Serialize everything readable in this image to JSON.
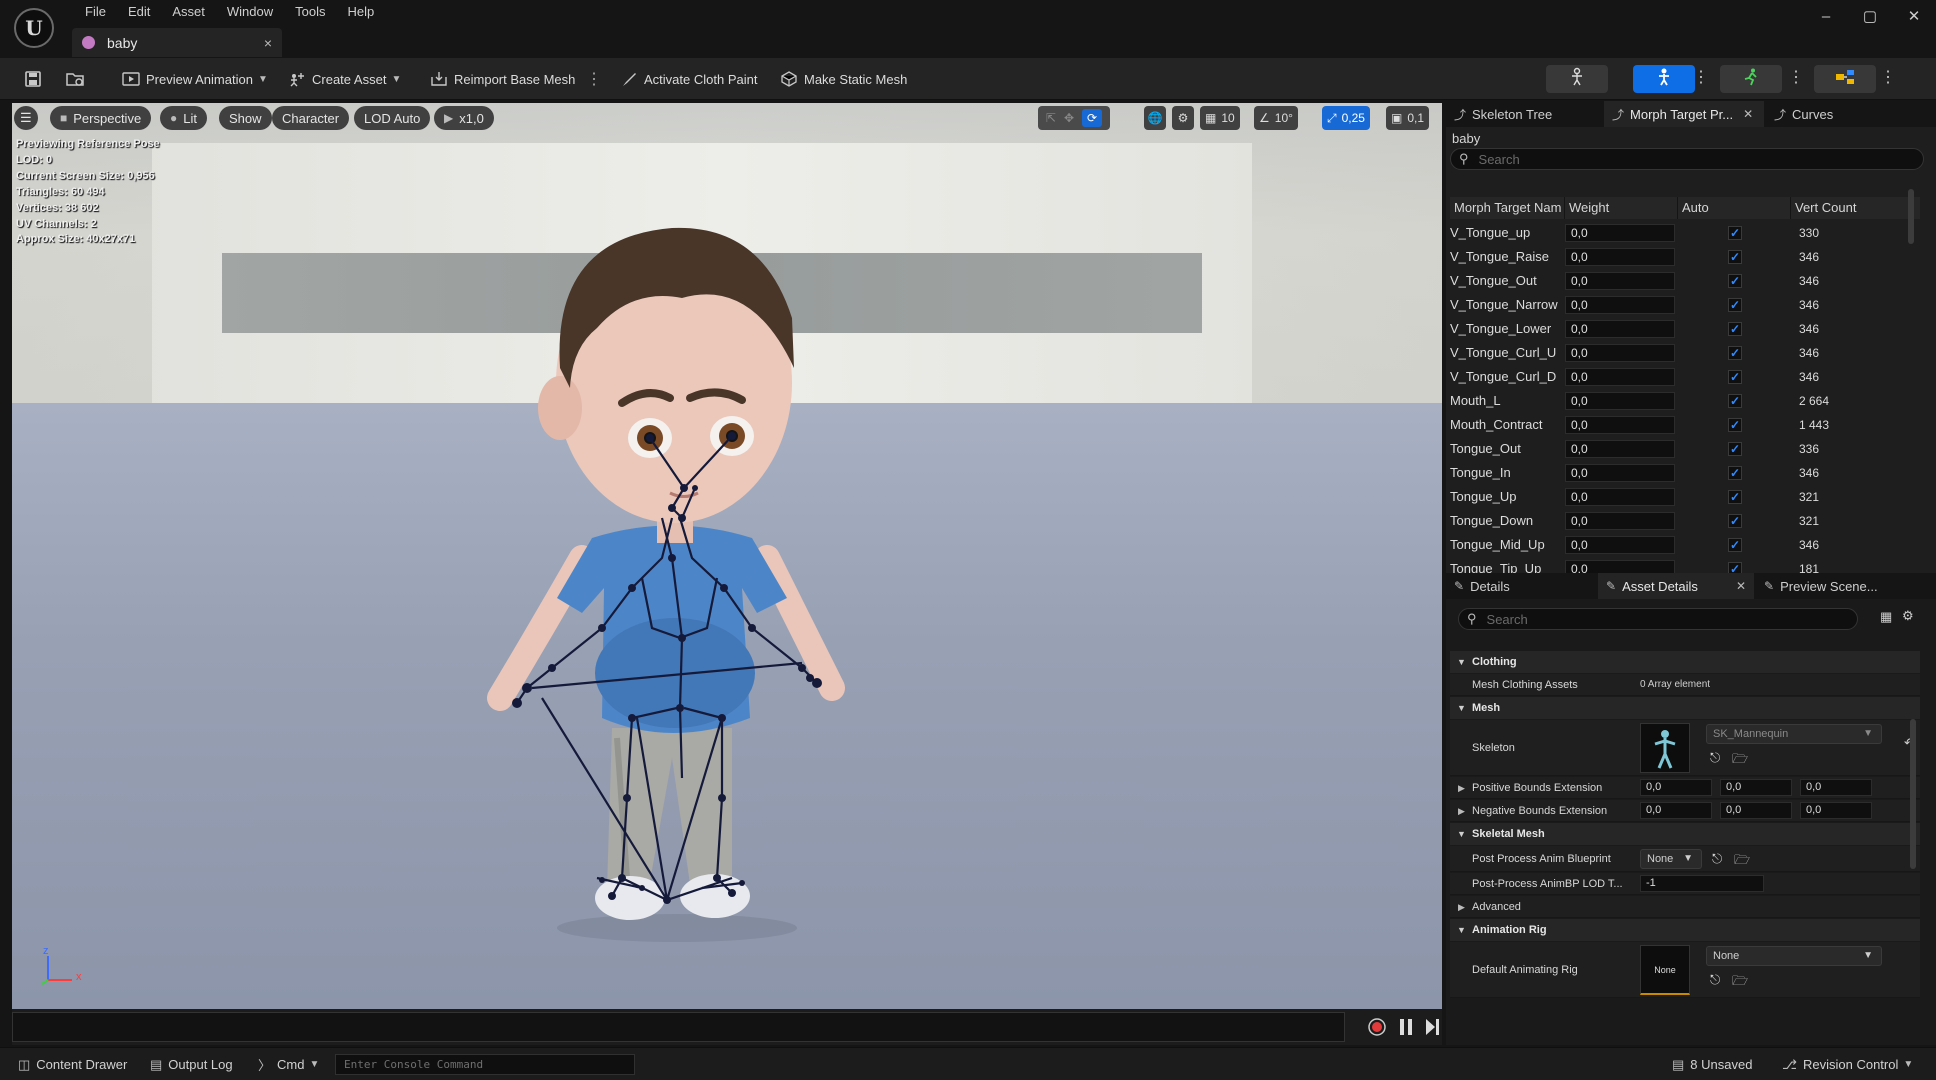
{
  "menu": [
    "File",
    "Edit",
    "Asset",
    "Window",
    "Tools",
    "Help"
  ],
  "doc_tab": {
    "label": "baby",
    "close": "×"
  },
  "window_controls": {
    "minimize": "–",
    "maximize": "▢",
    "close": "✕"
  },
  "toolbar": {
    "preview_animation": "Preview Animation",
    "create_asset": "Create Asset",
    "reimport_base_mesh": "Reimport Base Mesh",
    "activate_cloth_paint": "Activate Cloth Paint",
    "make_static_mesh": "Make Static Mesh"
  },
  "viewport": {
    "perspective": "Perspective",
    "lit": "Lit",
    "show": "Show",
    "character": "Character",
    "lod": "LOD Auto",
    "speed": "x1,0",
    "grid_snap": "10",
    "angle_snap": "10°",
    "scale_snap": "0,25",
    "camera_speed": "0,1",
    "stats": [
      "Previewing Reference Pose",
      "LOD: 0",
      "Current Screen Size: 0,956",
      "Triangles: 60 494",
      "Vertices: 38 602",
      "UV Channels: 2",
      "Approx Size: 40x27x71"
    ],
    "axis_x": "x",
    "axis_z": "z"
  },
  "statusbar": {
    "content_drawer": "Content Drawer",
    "output_log": "Output Log",
    "cmd": "Cmd",
    "console_placeholder": "Enter Console Command",
    "unsaved": "8 Unsaved",
    "revision_control": "Revision Control"
  },
  "top_panel": {
    "tabs": [
      "Skeleton Tree",
      "Morph Target Pr...",
      "Curves"
    ],
    "asset_name": "baby",
    "search_placeholder": "Search",
    "columns": [
      "Morph Target Nam",
      "Weight",
      "Auto",
      "Vert Count"
    ],
    "rows": [
      {
        "name": "V_Tongue_up",
        "weight": "0,0",
        "vert": "330"
      },
      {
        "name": "V_Tongue_Raise",
        "weight": "0,0",
        "vert": "346"
      },
      {
        "name": "V_Tongue_Out",
        "weight": "0,0",
        "vert": "346"
      },
      {
        "name": "V_Tongue_Narrow",
        "weight": "0,0",
        "vert": "346"
      },
      {
        "name": "V_Tongue_Lower",
        "weight": "0,0",
        "vert": "346"
      },
      {
        "name": "V_Tongue_Curl_U",
        "weight": "0,0",
        "vert": "346"
      },
      {
        "name": "V_Tongue_Curl_D",
        "weight": "0,0",
        "vert": "346"
      },
      {
        "name": "Mouth_L",
        "weight": "0,0",
        "vert": "2 664"
      },
      {
        "name": "Mouth_Contract",
        "weight": "0,0",
        "vert": "1 443"
      },
      {
        "name": "Tongue_Out",
        "weight": "0,0",
        "vert": "336"
      },
      {
        "name": "Tongue_In",
        "weight": "0,0",
        "vert": "346"
      },
      {
        "name": "Tongue_Up",
        "weight": "0,0",
        "vert": "321"
      },
      {
        "name": "Tongue_Down",
        "weight": "0,0",
        "vert": "321"
      },
      {
        "name": "Tongue_Mid_Up",
        "weight": "0,0",
        "vert": "346"
      },
      {
        "name": "Tongue_Tip_Up",
        "weight": "0,0",
        "vert": "181"
      }
    ]
  },
  "details_panel": {
    "tabs": [
      "Details",
      "Asset Details",
      "Preview Scene..."
    ],
    "search_placeholder": "Search",
    "clothing": {
      "header": "Clothing",
      "mesh_clothing_assets": "Mesh Clothing Assets",
      "mesh_clothing_value": "0 Array element"
    },
    "mesh": {
      "header": "Mesh",
      "skeleton": "Skeleton",
      "skeleton_value": "SK_Mannequin",
      "positive_bounds": "Positive Bounds Extension",
      "negative_bounds": "Negative Bounds Extension",
      "bounds_values": [
        "0,0",
        "0,0",
        "0,0"
      ]
    },
    "skeletal_mesh": {
      "header": "Skeletal Mesh",
      "post_process_bp": "Post Process Anim Blueprint",
      "post_process_bp_value": "None",
      "post_process_lod": "Post-Process AnimBP LOD T...",
      "post_process_lod_value": "-1"
    },
    "advanced": "Advanced",
    "animation_rig": {
      "header": "Animation Rig",
      "default_rig": "Default Animating Rig",
      "thumb_label": "None",
      "rig_value": "None"
    }
  }
}
